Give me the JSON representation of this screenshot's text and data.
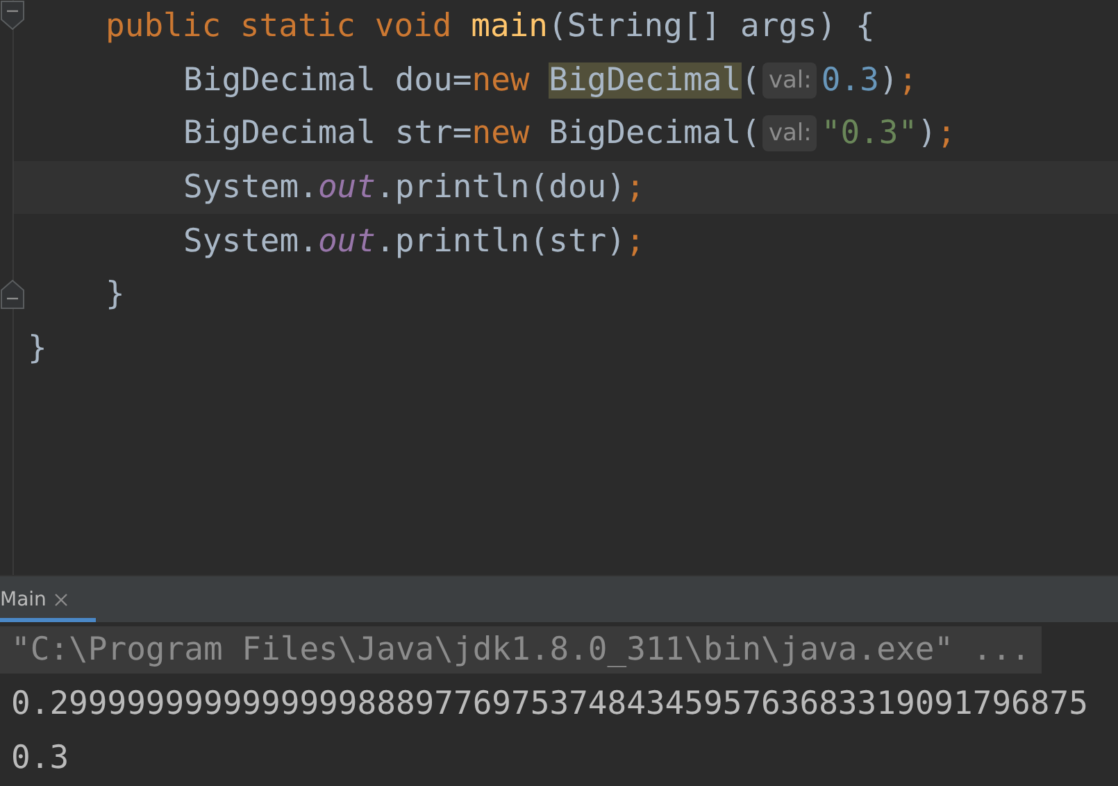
{
  "editor": {
    "lines": [
      {
        "tokens": [
          {
            "text": "public static void ",
            "kind": "keyword"
          },
          {
            "text": "main",
            "kind": "method"
          },
          {
            "text": "(String[] args) {",
            "kind": "plain"
          }
        ],
        "fold": true,
        "children": [
          {
            "tokens": [
              {
                "text": "BigDecimal dou=",
                "kind": "plain"
              },
              {
                "text": "new ",
                "kind": "keyword"
              },
              {
                "text": "BigDecimal",
                "kind": "highlight"
              },
              {
                "text": "(",
                "kind": "plain"
              },
              {
                "text": "val:",
                "kind": "hint"
              },
              {
                "text": "0.3",
                "kind": "number"
              },
              {
                "text": ")",
                "kind": "plain"
              },
              {
                "text": ";",
                "kind": "keyword"
              }
            ],
            "current": false
          },
          {
            "tokens": [
              {
                "text": "BigDecimal str=",
                "kind": "plain"
              },
              {
                "text": "new ",
                "kind": "keyword"
              },
              {
                "text": "BigDecimal(",
                "kind": "plain"
              },
              {
                "text": "val:",
                "kind": "hint"
              },
              {
                "text": "\"0.3\"",
                "kind": "string"
              },
              {
                "text": ")",
                "kind": "plain"
              },
              {
                "text": ";",
                "kind": "keyword"
              }
            ],
            "current": false
          },
          {
            "tokens": [
              {
                "text": "System.",
                "kind": "plain"
              },
              {
                "text": "out",
                "kind": "field"
              },
              {
                "text": ".println(dou)",
                "kind": "plain"
              },
              {
                "text": ";",
                "kind": "keyword"
              }
            ],
            "current": true
          },
          {
            "tokens": [
              {
                "text": "System.",
                "kind": "plain"
              },
              {
                "text": "out",
                "kind": "field"
              },
              {
                "text": ".println(str)",
                "kind": "plain"
              },
              {
                "text": ";",
                "kind": "keyword"
              }
            ],
            "current": false
          }
        ]
      },
      {
        "tokens": [
          {
            "text": "}",
            "kind": "plain"
          }
        ],
        "fold": true
      }
    ],
    "outer_line": {
      "tokens": [
        {
          "text": "}",
          "kind": "plain"
        }
      ]
    }
  },
  "run_panel": {
    "tabs": [
      {
        "label": "Main",
        "selected": true
      }
    ],
    "output": [
      {
        "text": "\"C:\\Program Files\\Java\\jdk1.8.0_311\\bin\\java.exe\" ...",
        "kind": "command"
      },
      {
        "text": "0.299999999999999988897769753748434595763683319091796875",
        "kind": "stdout"
      },
      {
        "text": "0.3",
        "kind": "stdout"
      }
    ]
  }
}
